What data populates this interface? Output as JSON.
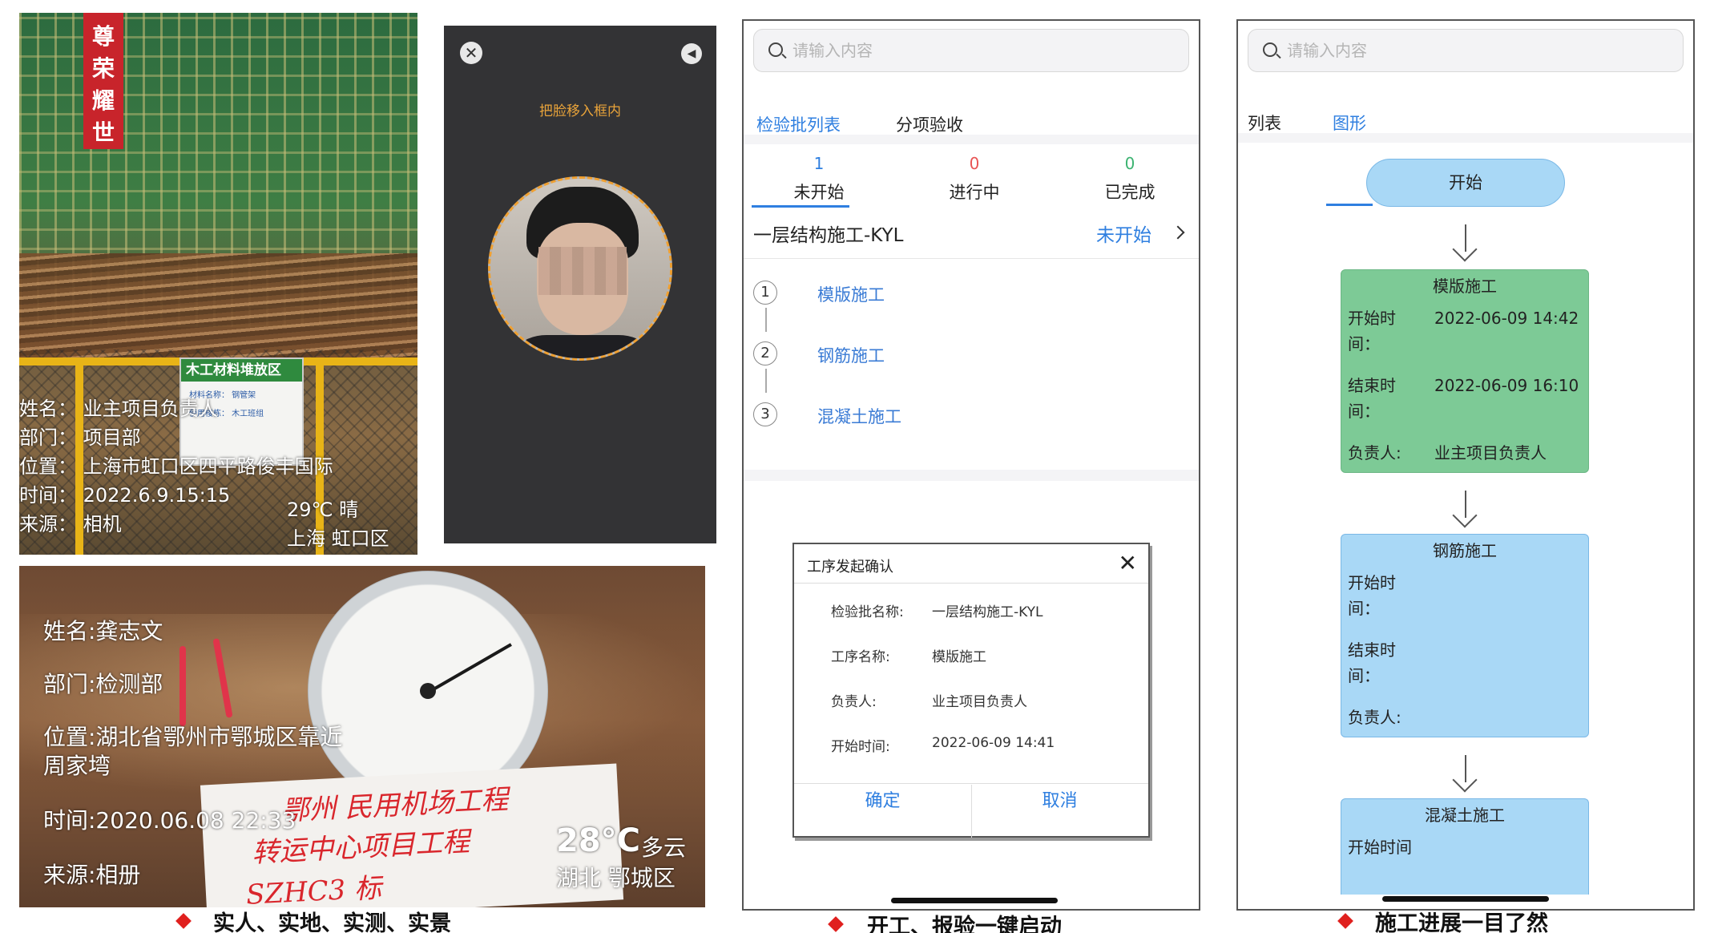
{
  "construction_photo": {
    "banner": "尊荣耀世",
    "sign_title": "木工材料堆放区",
    "sign_line1": "材料名称：    钢管架",
    "sign_line2": "使用楼栋：    木工班组",
    "name": "姓名：  业主项目负责人",
    "dept": "部门：  项目部",
    "location": "位置：  上海市虹口区四平路俊丰国际",
    "time": "时间：  2022.6.9.15:15",
    "source": "来源：  相机",
    "weather": "29℃  晴",
    "region": "上海  虹口区"
  },
  "face_capture": {
    "close_icon": "close-icon",
    "sound_icon": "speaker-icon",
    "hint": "把脸移入框内"
  },
  "gauge_photo": {
    "name": "姓名:龚志文",
    "dept": "部门:检测部",
    "location_line1": "位置:湖北省鄂州市鄂城区靠近",
    "location_line2": "周家塆",
    "time": "时间:2020.06.08 22:33",
    "source": "来源:相册",
    "weather_temp": "28°C",
    "weather_desc": "多云",
    "region": "湖北  鄂城区",
    "handwriting_line1": "鄂州 民用机场工程",
    "handwriting_line2": "转运中心项目工程",
    "handwriting_line3": "SZHC3 标"
  },
  "inspection_app": {
    "search": {
      "placeholder": "请输入内容"
    },
    "tabs": [
      {
        "label": "检验批列表"
      },
      {
        "label": "分项验收"
      }
    ],
    "counters": [
      {
        "value": "1",
        "label": "未开始",
        "color": "#2f7fe0"
      },
      {
        "value": "0",
        "label": "进行中",
        "color": "#e85454"
      },
      {
        "value": "0",
        "label": "已完成",
        "color": "#3cb371"
      }
    ],
    "batch": {
      "title": "一层结构施工-KYL",
      "status": "未开始"
    },
    "steps": [
      {
        "num": "1",
        "label": "模版施工"
      },
      {
        "num": "2",
        "label": "钢筋施工"
      },
      {
        "num": "3",
        "label": "混凝土施工"
      }
    ],
    "dialog": {
      "title": "工序发起确认",
      "rows": [
        {
          "label": "检验批名称:",
          "value": "一层结构施工-KYL"
        },
        {
          "label": "工序名称:",
          "value": "模版施工"
        },
        {
          "label": "负责人:",
          "value": "业主项目负责人"
        },
        {
          "label": "开始时间:",
          "value": "2022-06-09 14:41"
        }
      ],
      "confirm": "确定",
      "cancel": "取消"
    }
  },
  "graph_app": {
    "search": {
      "placeholder": "请输入内容"
    },
    "tabs": [
      {
        "label": "列表"
      },
      {
        "label": "图形"
      }
    ],
    "start": "开始",
    "nodes": [
      {
        "title": "模版施工",
        "start_label": "开始时间：",
        "start_value": "2022-06-09 14:42",
        "end_label": "结束时间：",
        "end_value": "2022-06-09 16:10",
        "owner_label": "负责人:",
        "owner_value": "业主项目负责人",
        "color": "#7dca96"
      },
      {
        "title": "钢筋施工",
        "start_label": "开始时间：",
        "start_value": "",
        "end_label": "结束时间：",
        "end_value": "",
        "owner_label": "负责人:",
        "owner_value": "",
        "color": "#a9d8f6"
      },
      {
        "title": "混凝土施工",
        "start_label": "开始时间",
        "color": "#a9d8f6"
      }
    ]
  },
  "captions": [
    "实人、实地、实测、实景",
    "开工、报验一键启动",
    "施工进展一目了然"
  ],
  "accent_color": "#2f7fe0",
  "caption_marker_color": "#e0201e"
}
